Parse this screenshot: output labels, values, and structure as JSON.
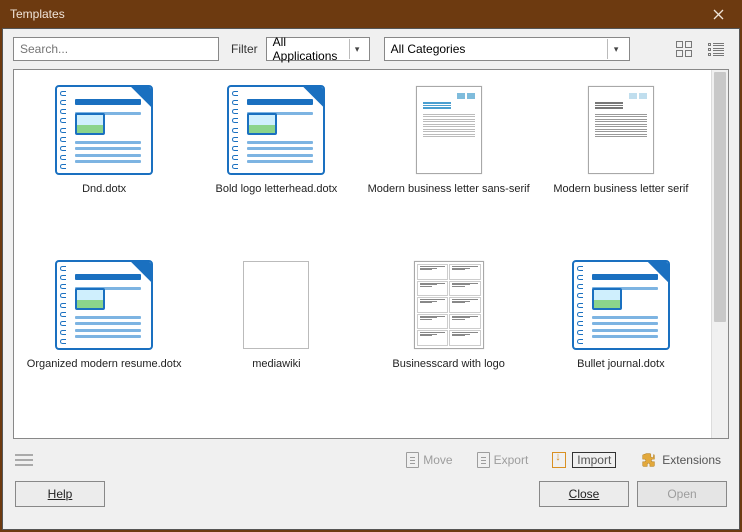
{
  "window": {
    "title": "Templates"
  },
  "toolbar": {
    "search_placeholder": "Search...",
    "filter_label": "Filter",
    "app_filter": "All Applications",
    "cat_filter": "All Categories"
  },
  "templates": [
    {
      "label": "Dnd.dotx",
      "kind": "doc"
    },
    {
      "label": "Bold logo letterhead.dotx",
      "kind": "doc"
    },
    {
      "label": "Modern business letter sans-serif",
      "kind": "letter"
    },
    {
      "label": "Modern business letter serif",
      "kind": "letter-serif"
    },
    {
      "label": "Organized modern resume.dotx",
      "kind": "doc"
    },
    {
      "label": "mediawiki",
      "kind": "blank"
    },
    {
      "label": "Businesscard with logo",
      "kind": "card"
    },
    {
      "label": "Bullet journal.dotx",
      "kind": "doc"
    }
  ],
  "actions": {
    "move": "Move",
    "export": "Export",
    "import": "Import",
    "extensions": "Extensions"
  },
  "buttons": {
    "help": "Help",
    "close": "Close",
    "open": "Open"
  }
}
